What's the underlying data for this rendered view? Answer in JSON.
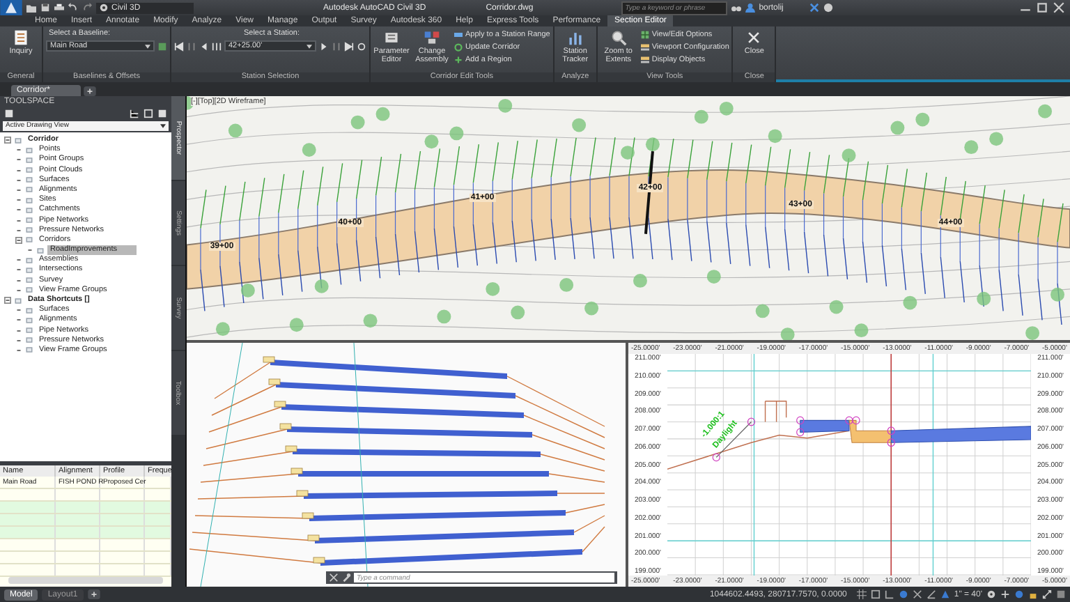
{
  "title_bar": {
    "workspace": "Civil 3D",
    "title": "Autodesk AutoCAD Civil 3D",
    "file": "Corridor.dwg",
    "search": {
      "placeholder": "Type a keyword or phrase"
    },
    "user": "bortolij"
  },
  "ribbon_tabs": [
    {
      "label": "Home",
      "selected": false
    },
    {
      "label": "Insert",
      "selected": false
    },
    {
      "label": "Annotate",
      "selected": false
    },
    {
      "label": "Modify",
      "selected": false
    },
    {
      "label": "Analyze",
      "selected": false
    },
    {
      "label": "View",
      "selected": false
    },
    {
      "label": "Manage",
      "selected": false
    },
    {
      "label": "Output",
      "selected": false
    },
    {
      "label": "Survey",
      "selected": false
    },
    {
      "label": "Autodesk 360",
      "selected": false
    },
    {
      "label": "Help",
      "selected": false
    },
    {
      "label": "Express Tools",
      "selected": false
    },
    {
      "label": "Performance",
      "selected": false
    },
    {
      "label": "Section Editor",
      "selected": true
    }
  ],
  "ribbon_panels": [
    {
      "title": "General",
      "items": [
        {
          "kind": "large",
          "label": "Inquiry"
        }
      ]
    },
    {
      "title": "Baselines & Offsets",
      "items": [
        {
          "kind": "select",
          "label": "Select a Baseline:",
          "value": "Main Road"
        }
      ]
    },
    {
      "title": "Station Selection",
      "items": [
        {
          "kind": "station",
          "label": "Select a Station:",
          "value": "42+25.00'"
        }
      ]
    },
    {
      "title": "Corridor Edit Tools",
      "items": [
        {
          "kind": "large",
          "label": "Parameter Editor"
        },
        {
          "kind": "large",
          "label": "Change Assembly"
        },
        {
          "kind": "small",
          "label": "Apply to a Station Range"
        },
        {
          "kind": "small",
          "label": "Update Corridor"
        },
        {
          "kind": "small",
          "label": "Add a Region"
        }
      ]
    },
    {
      "title": "Analyze",
      "items": [
        {
          "kind": "large",
          "label": "Station Tracker"
        }
      ]
    },
    {
      "title": "View Tools",
      "items": [
        {
          "kind": "large",
          "label": "Zoom to Extents"
        },
        {
          "kind": "small",
          "label": "View/Edit Options"
        },
        {
          "kind": "small",
          "label": "Viewport Configuration"
        },
        {
          "kind": "small",
          "label": "Display Objects"
        }
      ]
    },
    {
      "title": "Close",
      "items": [
        {
          "kind": "large",
          "label": "Close"
        }
      ]
    }
  ],
  "document_tabs": [
    {
      "label": "Corridor*",
      "selected": true
    }
  ],
  "toolspace": {
    "title": "TOOLSPACE",
    "view": "Active Drawing View",
    "tree": [
      {
        "label": "Corridor",
        "selected": false,
        "children": [
          {
            "label": "Points",
            "selected": false
          },
          {
            "label": "Point Groups",
            "selected": false
          },
          {
            "label": "Point Clouds",
            "selected": false
          },
          {
            "label": "Surfaces",
            "selected": false
          },
          {
            "label": "Alignments",
            "selected": false
          },
          {
            "label": "Sites",
            "selected": false
          },
          {
            "label": "Catchments",
            "selected": false
          },
          {
            "label": "Pipe Networks",
            "selected": false
          },
          {
            "label": "Pressure Networks",
            "selected": false
          },
          {
            "label": "Corridors",
            "selected": false,
            "children": [
              {
                "label": "RoadImprovements",
                "selected": true
              }
            ]
          },
          {
            "label": "Assemblies",
            "selected": false
          },
          {
            "label": "Intersections",
            "selected": false
          },
          {
            "label": "Survey",
            "selected": false
          },
          {
            "label": "View Frame Groups",
            "selected": false
          }
        ]
      },
      {
        "label": "Data Shortcuts []",
        "selected": false,
        "children": [
          {
            "label": "Surfaces",
            "selected": false
          },
          {
            "label": "Alignments",
            "selected": false
          },
          {
            "label": "Pipe Networks",
            "selected": false
          },
          {
            "label": "Pressure Networks",
            "selected": false
          },
          {
            "label": "View Frame Groups",
            "selected": false
          }
        ]
      }
    ],
    "side_tabs": [
      {
        "label": "Prospector",
        "selected": true
      },
      {
        "label": "Settings",
        "selected": false
      },
      {
        "label": "Survey",
        "selected": false
      },
      {
        "label": "Toolbox",
        "selected": false
      }
    ]
  },
  "table": {
    "columns": [
      "Name",
      "Alignment",
      "Profile",
      "Freque"
    ],
    "rows": [
      {
        "name": "Main Road",
        "alignment": "FISH POND R",
        "profile": "Proposed Cer"
      }
    ]
  },
  "plan_view": {
    "label": "[-][Top][2D Wireframe]",
    "stations": [
      "39+00",
      "40+00",
      "41+00",
      "42+00",
      "43+00",
      "44+00"
    ]
  },
  "section_view": {
    "offsets_top": [
      "-25.0000'",
      "-23.0000'",
      "-21.0000'",
      "-19.0000'",
      "-17.0000'",
      "-15.0000'",
      "-13.0000'",
      "-11.0000'",
      "-9.0000'",
      "-7.0000'",
      "-5.0000'"
    ],
    "elevations_left": [
      "211.000'",
      "210.000'",
      "209.000'",
      "208.000'",
      "207.000'",
      "206.000'",
      "205.000'",
      "204.000'",
      "203.000'",
      "202.000'",
      "201.000'",
      "200.000'",
      "199.000'"
    ],
    "elevations_right": [
      "211.000'",
      "210.000'",
      "209.000'",
      "208.000'",
      "207.000'",
      "206.000'",
      "205.000'",
      "204.000'",
      "203.000'",
      "202.000'",
      "201.000'",
      "200.000'",
      "199.000'"
    ],
    "offsets_bottom": [
      "-25.0000'",
      "-23.0000'",
      "-21.0000'",
      "-19.0000'",
      "-17.0000'",
      "-15.0000'",
      "-13.0000'",
      "-11.0000'",
      "-9.0000'",
      "-7.0000'",
      "-5.0000'"
    ],
    "slope_label": "-1.000:1",
    "slope_name": "Daylight"
  },
  "command_line": {
    "placeholder": "Type a command"
  },
  "layout_tabs": [
    {
      "label": "Model",
      "selected": true
    },
    {
      "label": "Layout1",
      "selected": false
    }
  ],
  "status_bar": {
    "coordinates": "1044602.4493, 280717.7570, 0.0000",
    "scale": "1\" = 40'"
  }
}
